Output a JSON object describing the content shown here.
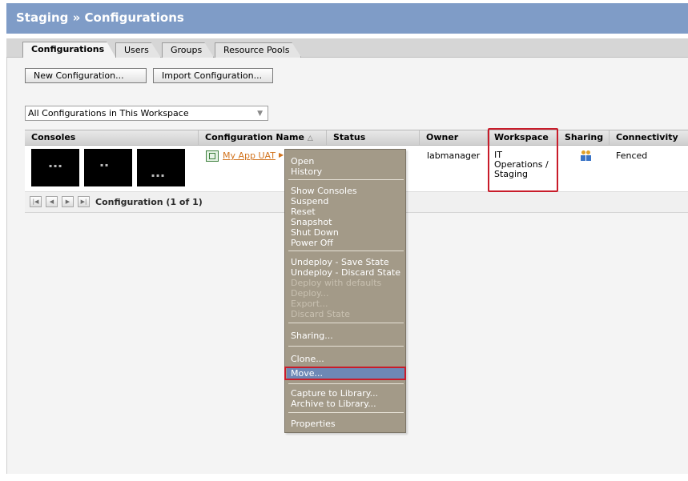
{
  "header": {
    "title": "Staging » Configurations"
  },
  "tabs": [
    {
      "label": "Configurations",
      "active": true
    },
    {
      "label": "Users"
    },
    {
      "label": "Groups"
    },
    {
      "label": "Resource Pools"
    }
  ],
  "toolbar": {
    "new_label": "New Configuration...",
    "import_label": "Import Configuration..."
  },
  "filter": {
    "selected": "All Configurations in This Workspace"
  },
  "grid": {
    "columns": [
      "Consoles",
      "Configuration Name",
      "Status",
      "Owner",
      "Workspace",
      "Sharing",
      "Connectivity"
    ],
    "sort_indicator": "△",
    "row": {
      "name": "My App UAT",
      "owner": "labmanager",
      "workspace_lines": [
        "IT",
        "Operations /",
        "Staging"
      ],
      "connectivity": "Fenced"
    }
  },
  "pager": {
    "text": "Configuration (1 of 1)"
  },
  "menu": {
    "items": [
      {
        "label": "Open"
      },
      {
        "label": "History"
      },
      {
        "label": "Show Consoles"
      },
      {
        "label": "Suspend"
      },
      {
        "label": "Reset"
      },
      {
        "label": "Snapshot"
      },
      {
        "label": "Shut Down"
      },
      {
        "label": "Power Off"
      },
      {
        "label": "Undeploy - Save State"
      },
      {
        "label": "Undeploy - Discard State"
      },
      {
        "label": "Deploy with defaults",
        "disabled": true
      },
      {
        "label": "Deploy...",
        "disabled": true
      },
      {
        "label": "Export...",
        "disabled": true
      },
      {
        "label": "Discard State",
        "disabled": true
      },
      {
        "label": "Sharing..."
      },
      {
        "label": "Clone..."
      },
      {
        "label": "Move..."
      },
      {
        "label": "Capture to Library..."
      },
      {
        "label": "Archive to Library..."
      },
      {
        "label": "Properties"
      }
    ]
  },
  "colors": {
    "header": "#7f9cc7",
    "menu": "#a39a88",
    "highlight": "#c81c2a"
  }
}
